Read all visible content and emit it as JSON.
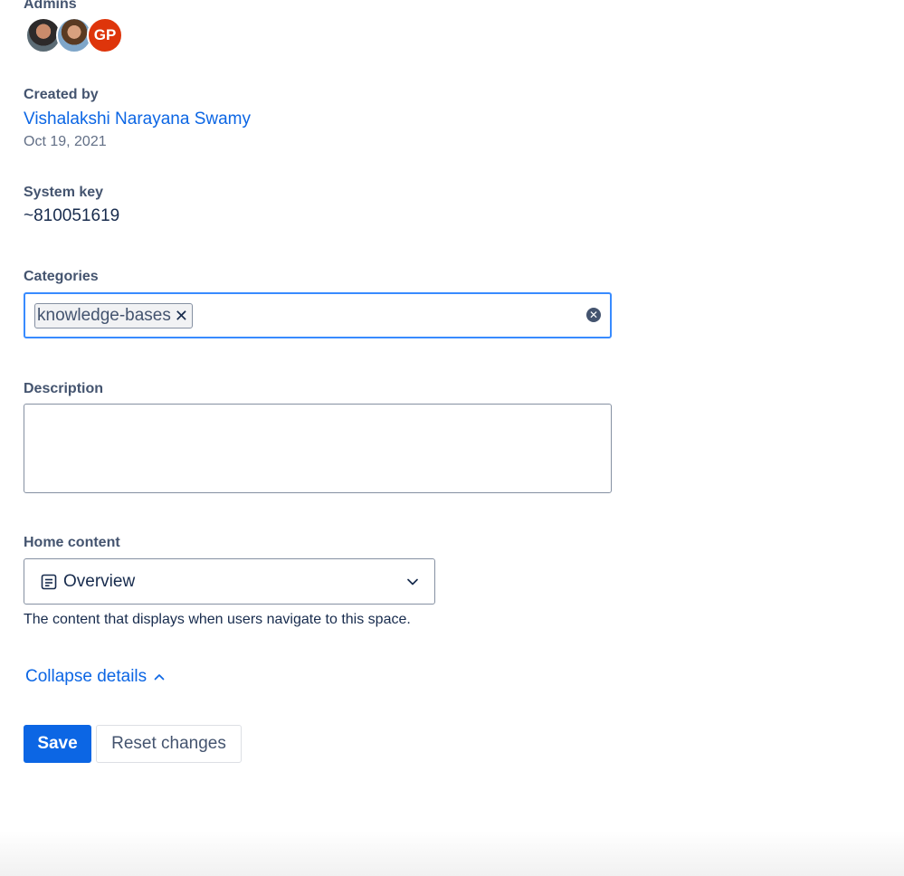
{
  "admins": {
    "label": "Admins",
    "avatars": [
      {
        "type": "photo"
      },
      {
        "type": "photo"
      },
      {
        "type": "initials",
        "initials": "GP",
        "color": "#de350b"
      }
    ]
  },
  "created_by": {
    "label": "Created by",
    "name": "Vishalakshi Narayana Swamy",
    "date": "Oct 19, 2021"
  },
  "system_key": {
    "label": "System key",
    "value": "~810051619"
  },
  "categories": {
    "label": "Categories",
    "tags": [
      "knowledge-bases"
    ],
    "tag_remove_icon": "close-icon",
    "clear_icon": "clear-circle-icon"
  },
  "description": {
    "label": "Description",
    "value": ""
  },
  "home_content": {
    "label": "Home content",
    "selected": "Overview",
    "icon": "page-icon",
    "helper": "The content that displays when users navigate to this space."
  },
  "collapse_link": {
    "label": "Collapse details",
    "icon": "chevron-up-icon"
  },
  "actions": {
    "save_label": "Save",
    "reset_label": "Reset changes"
  },
  "colors": {
    "primary": "#0c66e4",
    "focus_border": "#388bff",
    "avatar_gp": "#de350b"
  }
}
